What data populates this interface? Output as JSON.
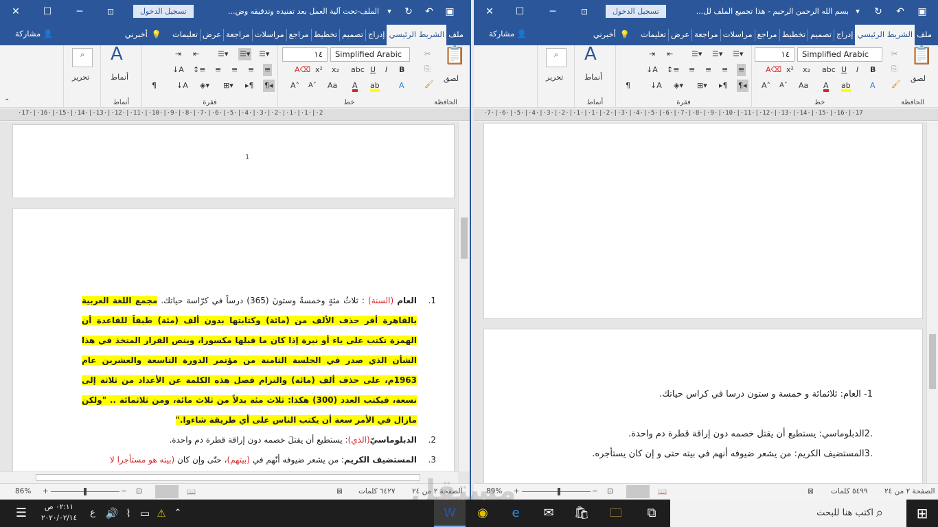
{
  "left": {
    "title": "الملف-تحت آلية العمل بعد تفنيده وتدقيقه وض...",
    "signin": "تسجيل الدخول",
    "tabs": [
      "ملف",
      "الشريط الرئيسي",
      "إدراج",
      "تصميم",
      "تخطيط",
      "مراجع",
      "مراسلات",
      "مراجعة",
      "عرض",
      "تعليمات"
    ],
    "tellme": "أخبرني",
    "share": "مشاركة",
    "font_name": "Simplified Arabic",
    "font_size": "١٤",
    "ribbon": {
      "paste": "لصق",
      "styles": "أنماط",
      "editing": "تحرير",
      "clipboard": "الحافظة",
      "font": "خط",
      "paragraph": "فقرة",
      "styles_grp": "أنماط"
    },
    "ruler": "·17·|·16·|·15·|·14·|·13·|·12·|·11·|·10·|·9·|·8·|·7·|·6·|·5·|·4·|·3·|·2·|·1·|·1·|·2",
    "page_number": "1",
    "doc": {
      "item1_num": "1.",
      "item1_word": "العام",
      "item1_red": "(السنة)",
      "item1_text": ": ثلاثُ مئةٍ وخمسةٌ وستونَ (365) درساً في كرّاسة حياتك.",
      "item1_bold": "مجمع اللغة العربية بالقاهرة أقر حذف الألف من (مائة) وكتابتها بدون ألف (مئة) طبقاً للقاعدة أن الهمزة تكتب على ياء أو نبرة إذا كان ما قبلها مكسورا، وينص القرار المتخذ في هذا الشأن الذي صدر في الجلسة الثامنة من مؤتمر الدورة التاسعة والعشرين عام 1963م، على حذف ألف (مائة) والتزام فصل هذه الكلمة عن الأعداد من ثلاثة إلى تسعة، فيكتب العدد (300) هكذا: ثلاث مئة بدلاً من ثلاث مائة، ومن ثلاثمائة .. \"ولكن مازال في الأمر سعة أن يكتب الناس على أي طريقة شاءوا.\"",
      "item2_num": "2.",
      "item2_word": "الدبلوماسيّ",
      "item2_red": "(الذي)",
      "item2_text": ": يستطيع أن يقتلَ خصمه دون إراقة قطرة دم واحدة.",
      "item3_num": "3.",
      "item3_word": "المستضيف الكريم",
      "item3_text1": ": من يشعر ضيوفه أنّهم في ",
      "item3_red1": "(بيتهم)",
      "item3_text2": "، حتّى وإن كان ",
      "item3_red2": "(بيته هو مستأجرا لا"
    },
    "status": {
      "page": "الصفحة ٢ من ٢٤",
      "words": "٦٤٢٧ كلمات",
      "zoom": "86%"
    }
  },
  "right": {
    "title": "بسم الله الرحمن الرحيم - هذا تجميع الملف لل...",
    "signin": "تسجيل الدخول",
    "tabs": [
      "ملف",
      "الشريط الرئيسي",
      "إدراج",
      "تصميم",
      "تخطيط",
      "مراجع",
      "مراسلات",
      "مراجعة",
      "عرض",
      "تعليمات"
    ],
    "tellme": "أخبرني",
    "share": "مشاركة",
    "font_name": "Simplified Arabic",
    "font_size": "١٤",
    "ribbon": {
      "paste": "لصق",
      "styles": "أنماط",
      "editing": "تحرير",
      "clipboard": "الحافظة",
      "font": "خط",
      "paragraph": "فقرة",
      "styles_grp": "أنماط"
    },
    "ruler": "·7·|·6·|·5·|·4·|·3·|·2·|·1·|·1·|·2·|·3·|·4·|·5·|·6·|·7·|·8·|·9·|·10·|·11·|·12·|·13·|·14·|·15·|·16·|·17",
    "doc": {
      "line1": "1- العام: ثلاثمائة و خمسة و ستون درسا في كراس حياتك.",
      "line2": ".2الدبلوماسي: يستطيع أن يقتل خصمه دون إراقة قطرة دم واحدة.",
      "line3": ".3المستضيف الكريم: من يشعر ضيوفه أنهم في بيته حتى و إن كان يستأجره."
    },
    "status": {
      "page": "الصفحة ٢ من ٢٤",
      "words": "٥٤٩٩ كلمات",
      "zoom": "89%"
    }
  },
  "taskbar": {
    "search_placeholder": "اكتب هنا للبحث",
    "time": "٠٢:١١ ص",
    "date": "٢٠٢٠/٠٢/١٤",
    "lang": "ع"
  },
  "watermark": {
    "ar": "مستقل",
    "en": "mostaql.com"
  },
  "colors": {
    "word_blue": "#2b579a",
    "highlight": "#ffff00",
    "red": "#d62828"
  }
}
